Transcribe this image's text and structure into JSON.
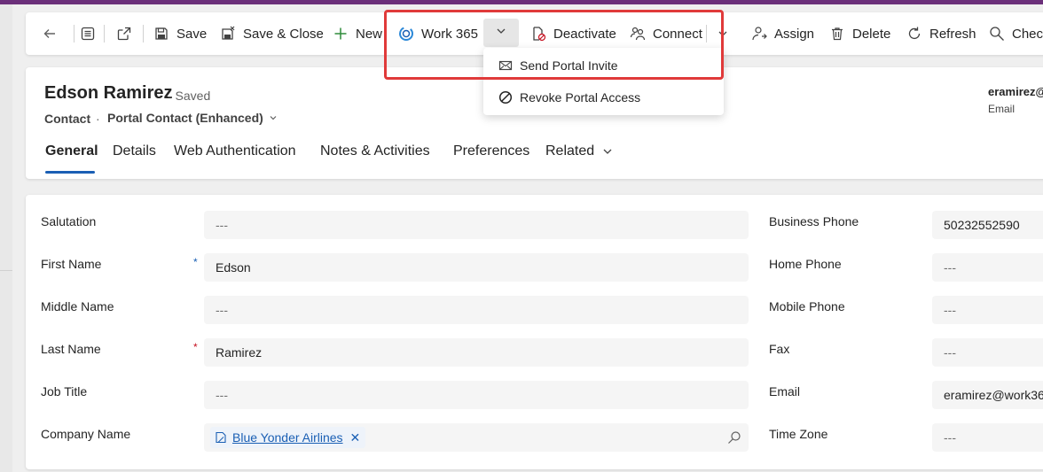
{
  "command_bar": {
    "back_label": "Back",
    "save": "Save",
    "save_close": "Save & Close",
    "new": "New",
    "work365": "Work 365",
    "deactivate": "Deactivate",
    "connect": "Connect",
    "assign": "Assign",
    "delete": "Delete",
    "refresh": "Refresh",
    "check": "Check"
  },
  "dropdown": {
    "items": [
      {
        "label": "Send Portal Invite",
        "icon": "mail-icon"
      },
      {
        "label": "Revoke Portal Access",
        "icon": "block-icon"
      }
    ]
  },
  "record": {
    "name": "Edson Ramirez",
    "status": "- Saved",
    "entity": "Contact",
    "separator": "·",
    "form": "Portal Contact (Enhanced)",
    "owner_value": "eramirez@",
    "owner_label": "Email"
  },
  "tabs": [
    "General",
    "Details",
    "Web Authentication",
    "Notes & Activities",
    "Preferences",
    "Related"
  ],
  "form": {
    "left": [
      {
        "label": "Salutation",
        "value": "---",
        "required": ""
      },
      {
        "label": "First Name",
        "value": "Edson",
        "required": "*"
      },
      {
        "label": "Middle Name",
        "value": "---",
        "required": ""
      },
      {
        "label": "Last Name",
        "value": "Ramirez",
        "required": "*"
      },
      {
        "label": "Job Title",
        "value": "---",
        "required": ""
      },
      {
        "label": "Company Name",
        "value": "Blue Yonder Airlines",
        "required": ""
      }
    ],
    "right": [
      {
        "label": "Business Phone",
        "value": "50232552590"
      },
      {
        "label": "Home Phone",
        "value": "---"
      },
      {
        "label": "Mobile Phone",
        "value": "---"
      },
      {
        "label": "Fax",
        "value": "---"
      },
      {
        "label": "Email",
        "value": "eramirez@work36"
      },
      {
        "label": "Time Zone",
        "value": "---"
      }
    ]
  },
  "colors": {
    "accent": "#1a5fb4",
    "highlight": "#e03a3a",
    "required": "#c50f1f",
    "top_bar": "#6b2f7a"
  }
}
